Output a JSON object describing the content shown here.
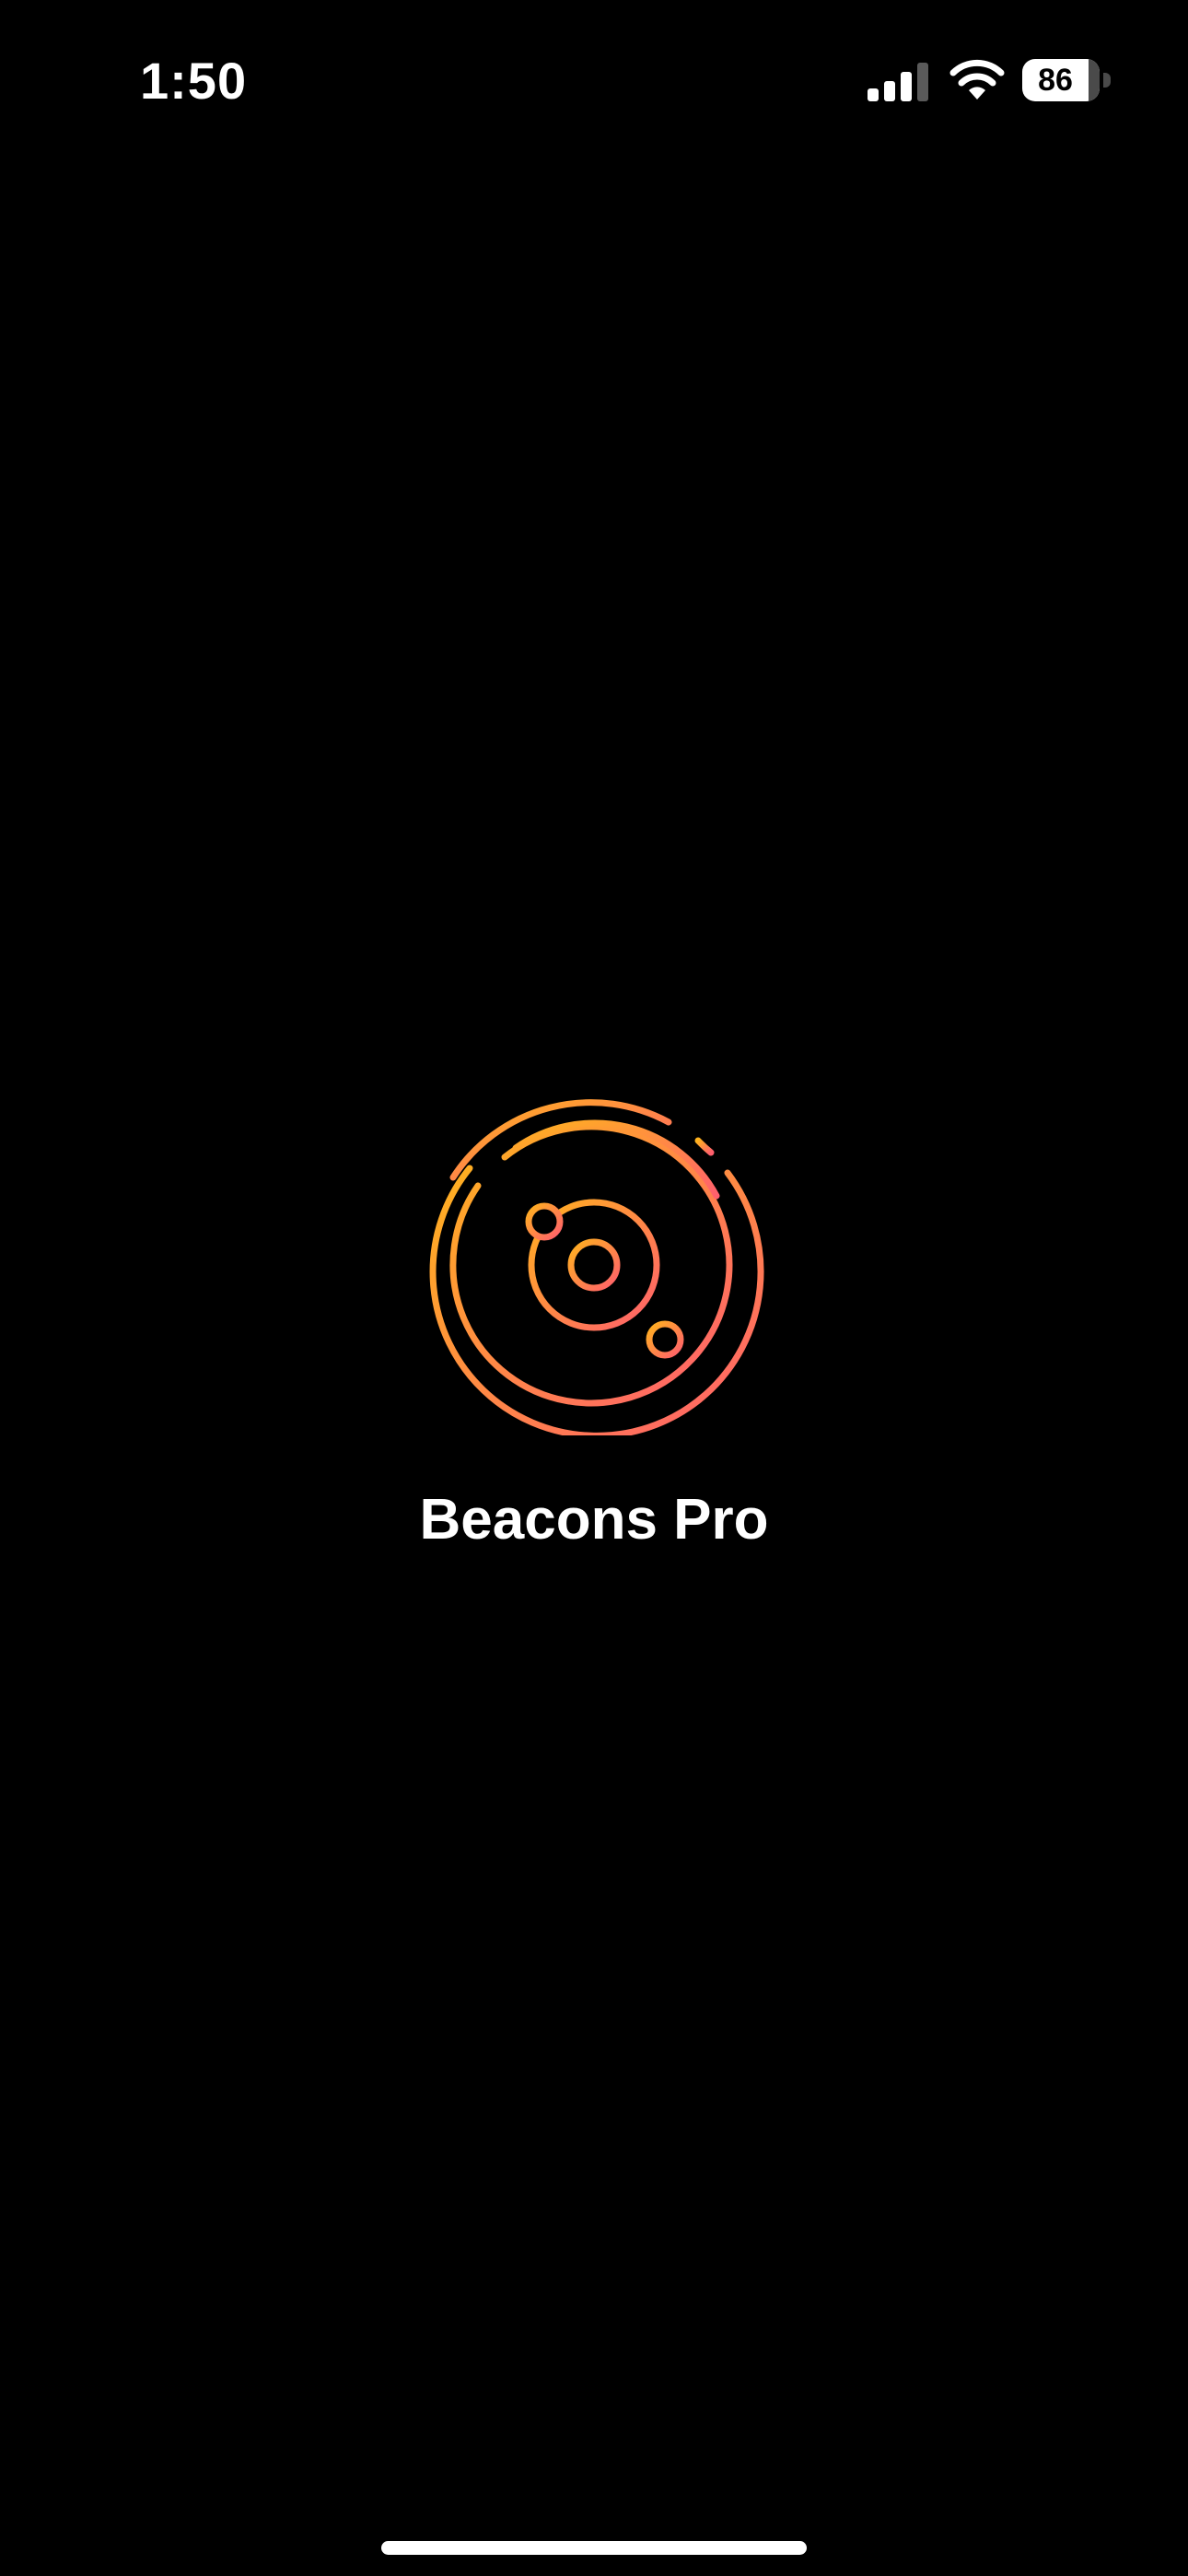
{
  "status_bar": {
    "time": "1:50",
    "battery_level": "86",
    "battery_fraction": 0.86,
    "signal_bars_active": 3,
    "signal_bars_total": 4
  },
  "splash": {
    "app_name": "Beacons Pro",
    "logo_icon": "radar-icon",
    "logo_gradient": [
      "#FFB21E",
      "#FF5F6D"
    ]
  },
  "colors": {
    "background": "#000000",
    "text": "#FFFFFF"
  }
}
